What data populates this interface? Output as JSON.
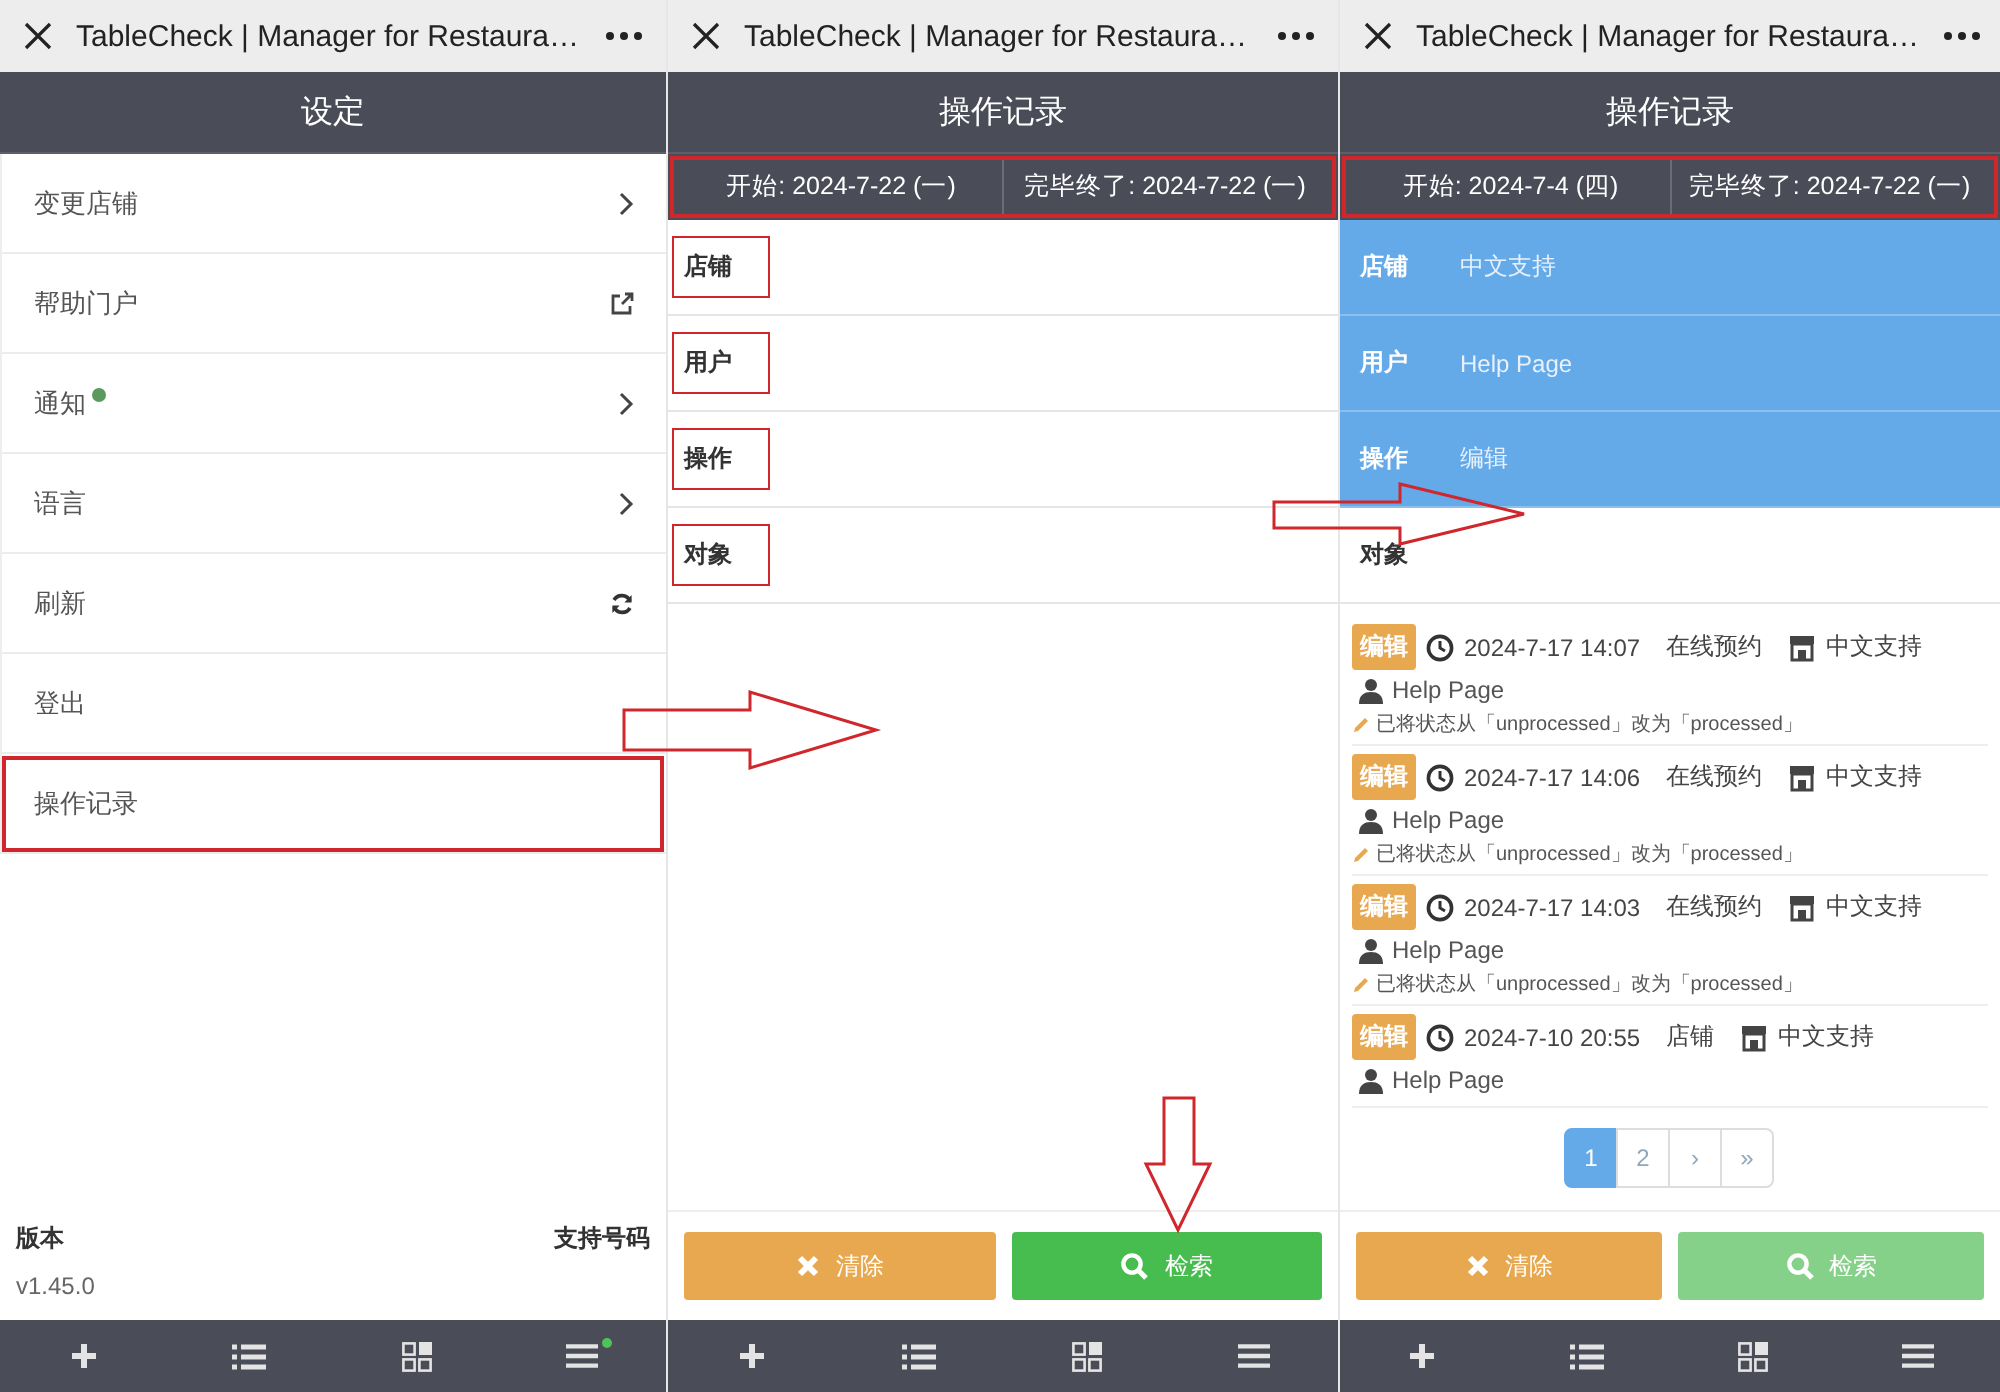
{
  "panels": [
    {
      "kind": "settings",
      "browser_title": "TableCheck | Manager for Restaura…",
      "header": "设定",
      "items": [
        {
          "label": "变更店铺",
          "kind": "chevron",
          "dot": false,
          "annotated": false
        },
        {
          "label": "帮助门户",
          "kind": "external",
          "dot": false,
          "annotated": false
        },
        {
          "label": "通知",
          "kind": "chevron",
          "dot": true,
          "annotated": false
        },
        {
          "label": "语言",
          "kind": "chevron",
          "dot": false,
          "annotated": false
        },
        {
          "label": "刷新",
          "kind": "refresh",
          "dot": false,
          "annotated": false
        },
        {
          "label": "登出",
          "kind": "plain",
          "dot": false,
          "annotated": false
        },
        {
          "label": "操作记录",
          "kind": "plain",
          "dot": false,
          "annotated": true
        }
      ],
      "footer": {
        "version_label": "版本",
        "support_label": "支持号码",
        "version": "v1.45.0"
      },
      "tab_bar": {
        "menu_dot": true
      }
    },
    {
      "kind": "log",
      "browser_title": "TableCheck | Manager for Restaura…",
      "header": "操作记录",
      "date_bar": {
        "start": "开始: 2024-7-22 (一)",
        "end": "完毕终了: 2024-7-22 (一)",
        "annotated": true
      },
      "filters": [
        {
          "label": "店铺",
          "active": false,
          "annotated": true
        },
        {
          "label": "用户",
          "active": false,
          "annotated": true
        },
        {
          "label": "操作",
          "active": false,
          "annotated": true
        },
        {
          "label": "对象",
          "active": false,
          "annotated": true
        }
      ],
      "buttons": [
        {
          "kind": "clear",
          "label": "清除",
          "disabled": false
        },
        {
          "kind": "search",
          "label": "检索",
          "disabled": false
        }
      ],
      "tab_bar": {
        "menu_dot": false
      }
    },
    {
      "kind": "log",
      "browser_title": "TableCheck | Manager for Restaura…",
      "header": "操作记录",
      "date_bar": {
        "start": "开始: 2024-7-4 (四)",
        "end": "完毕终了: 2024-7-22 (一)",
        "annotated": true
      },
      "filters": [
        {
          "label": "店铺",
          "value": "中文支持",
          "active": true,
          "annotated": false
        },
        {
          "label": "用户",
          "value": "Help Page",
          "active": true,
          "annotated": false
        },
        {
          "label": "操作",
          "value": "编辑",
          "active": true,
          "annotated": false
        },
        {
          "label": "对象",
          "active": false,
          "annotated": false
        }
      ],
      "entries": [
        {
          "action": "编辑",
          "time": "2024-7-17 14:07",
          "type": "在线预约",
          "store": "中文支持",
          "user": "Help Page",
          "note": "已将状态从「unprocessed」改为「processed」"
        },
        {
          "action": "编辑",
          "time": "2024-7-17 14:06",
          "type": "在线预约",
          "store": "中文支持",
          "user": "Help Page",
          "note": "已将状态从「unprocessed」改为「processed」"
        },
        {
          "action": "编辑",
          "time": "2024-7-17 14:03",
          "type": "在线预约",
          "store": "中文支持",
          "user": "Help Page",
          "note": "已将状态从「unprocessed」改为「processed」"
        },
        {
          "action": "编辑",
          "time": "2024-7-10 20:55",
          "type": "店铺",
          "store": "中文支持",
          "user": "Help Page"
        }
      ],
      "pagination": [
        {
          "label": "1",
          "selected": true
        },
        {
          "label": "2",
          "selected": false
        },
        {
          "label": "›",
          "selected": false
        },
        {
          "label": "»",
          "selected": false
        }
      ],
      "buttons": [
        {
          "kind": "clear",
          "label": "清除",
          "disabled": false
        },
        {
          "kind": "search",
          "label": "检索",
          "disabled": true
        }
      ],
      "tab_bar": {
        "menu_dot": false
      }
    }
  ]
}
